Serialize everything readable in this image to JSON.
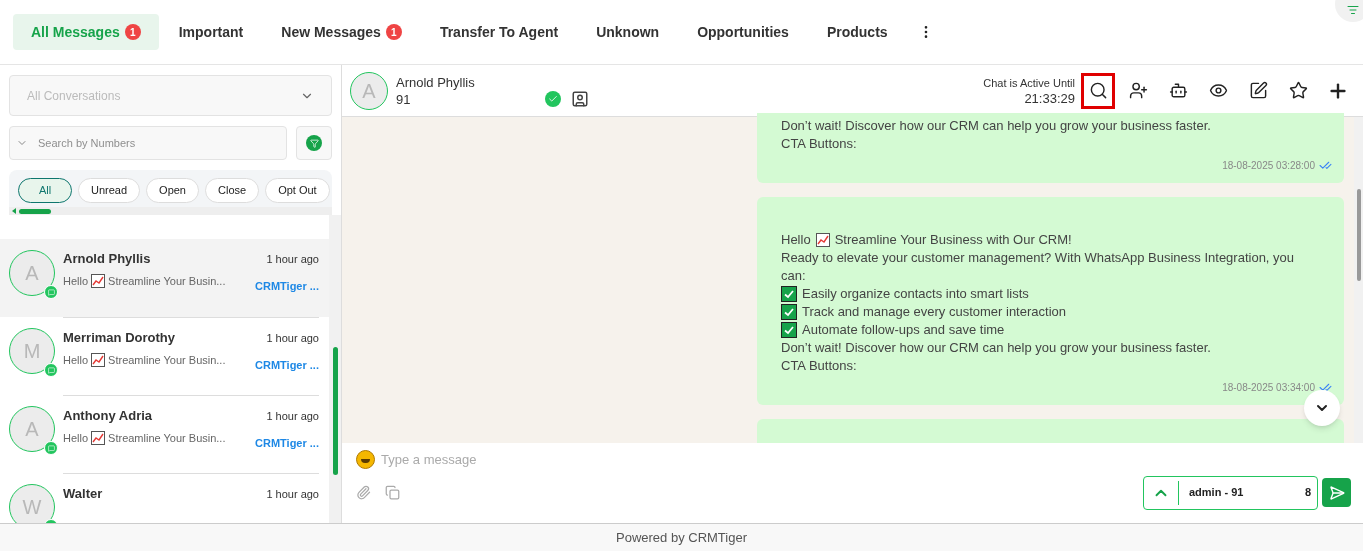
{
  "tabs": [
    {
      "label": "All Messages",
      "badge": "1",
      "selected": true
    },
    {
      "label": "Important",
      "selected": false
    },
    {
      "label": "New Messages",
      "badge": "1",
      "selected": false
    },
    {
      "label": "Transfer To Agent",
      "selected": false
    },
    {
      "label": "Unknown",
      "selected": false
    },
    {
      "label": "Opportunities",
      "selected": false
    },
    {
      "label": "Products",
      "selected": false
    }
  ],
  "sidebar": {
    "conversation_filter": {
      "placeholder": "All Conversations"
    },
    "search": {
      "placeholder": "Search by Numbers"
    },
    "chips": [
      {
        "label": "All",
        "selected": true
      },
      {
        "label": "Unread",
        "selected": false
      },
      {
        "label": "Open",
        "selected": false
      },
      {
        "label": "Close",
        "selected": false
      },
      {
        "label": "Opt Out",
        "selected": false
      }
    ],
    "conversations": [
      {
        "initial": "A",
        "name": "Arnold Phyllis",
        "time": "1 hour ago",
        "preview_start": "Hello",
        "preview_end": "Streamline Your Busin...",
        "source": "CRMTiger ...",
        "selected": true
      },
      {
        "initial": "M",
        "name": "Merriman Dorothy",
        "time": "1 hour ago",
        "preview_start": "Hello",
        "preview_end": "Streamline Your Busin...",
        "source": "CRMTiger ...",
        "selected": false
      },
      {
        "initial": "A",
        "name": "Anthony Adria",
        "time": "1 hour ago",
        "preview_start": "Hello",
        "preview_end": "Streamline Your Busin...",
        "source": "CRMTiger ...",
        "selected": false
      },
      {
        "initial": "W",
        "name": "Walter",
        "time": "1 hour ago",
        "selected": false
      }
    ]
  },
  "chat": {
    "contact": {
      "initial": "A",
      "name": "Arnold Phyllis",
      "number": "91"
    },
    "active_label": "Chat is Active Until",
    "active_time": "21:33:29",
    "toolbar": [
      {
        "kind": "search",
        "highlighted": true
      },
      {
        "kind": "add-user",
        "highlighted": false
      },
      {
        "kind": "bot",
        "highlighted": false
      },
      {
        "kind": "eye",
        "highlighted": false
      },
      {
        "kind": "edit",
        "highlighted": false
      },
      {
        "kind": "star",
        "highlighted": false
      },
      {
        "kind": "plus",
        "highlighted": false
      }
    ],
    "messages": [
      {
        "lines": [
          {
            "kind": "text",
            "text": "Don’t wait! Discover how our CRM can help you grow your business faster."
          },
          {
            "kind": "text",
            "text": "CTA Buttons:"
          }
        ],
        "time": "18-08-2025 03:28:00"
      },
      {
        "lines": [
          {
            "kind": "chart",
            "before": "Hello",
            "text": "Streamline Your Business with Our CRM!"
          },
          {
            "kind": "text",
            "text": "Ready to elevate your customer management? With WhatsApp Business Integration, you can:"
          },
          {
            "kind": "check",
            "text": "Easily organize contacts into smart lists"
          },
          {
            "kind": "check",
            "text": "Track and manage every customer interaction"
          },
          {
            "kind": "check",
            "text": "Automate follow-ups and save time"
          },
          {
            "kind": "text",
            "text": "Don’t wait! Discover how our CRM can help you grow your business faster."
          },
          {
            "kind": "text",
            "text": "CTA Buttons:"
          }
        ],
        "time": "18-08-2025 03:34:00"
      },
      {
        "kind": "partial"
      }
    ],
    "composer": {
      "placeholder": "Type a message",
      "sender_start": "admin - 91",
      "sender_end": "8"
    }
  },
  "footer": "Powered by CRMTiger"
}
